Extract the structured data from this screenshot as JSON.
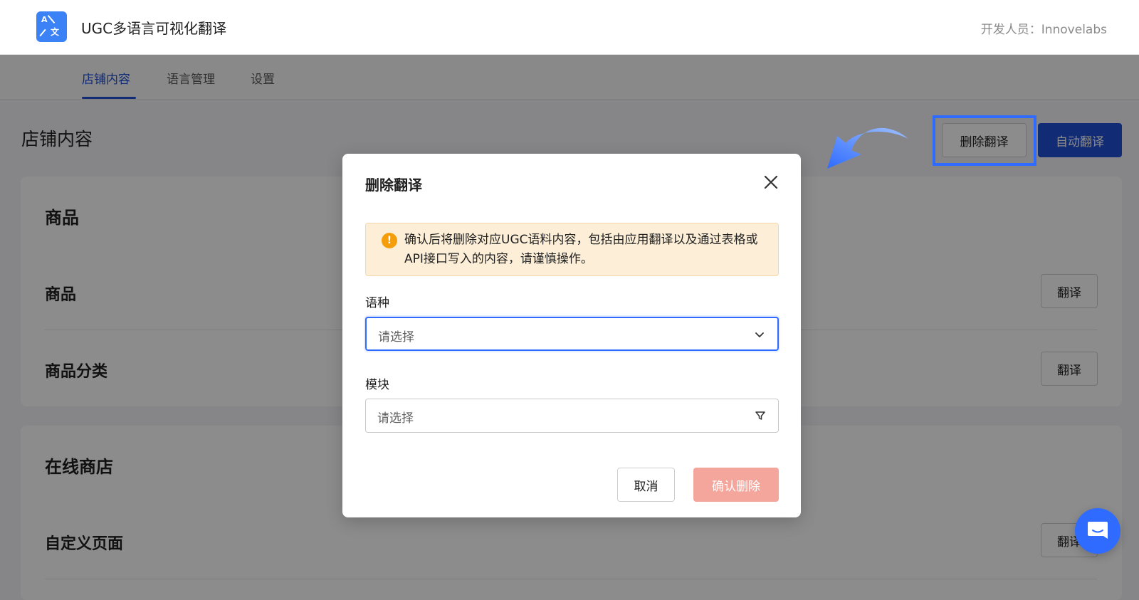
{
  "header": {
    "app_title": "UGC多语言可视化翻译",
    "developer": "开发人员：Innovelabs",
    "logo_glyph_a": "A",
    "logo_glyph_b": "文"
  },
  "tabs": [
    {
      "label": "店铺内容",
      "active": true
    },
    {
      "label": "语言管理",
      "active": false
    },
    {
      "label": "设置",
      "active": false
    }
  ],
  "page": {
    "title": "店铺内容",
    "delete_translation_label": "删除翻译",
    "auto_translate_label": "自动翻译"
  },
  "sections": [
    {
      "title": "商品",
      "rows": [
        {
          "label": "商品",
          "button": "翻译"
        },
        {
          "label": "商品分类",
          "button": "翻译"
        }
      ]
    },
    {
      "title": "在线商店",
      "rows": [
        {
          "label": "自定义页面",
          "button": "翻译"
        }
      ]
    }
  ],
  "modal": {
    "title": "删除翻译",
    "warning": "确认后将删除对应UGC语料内容，包括由应用翻译以及通过表格或API接口写入的内容，请谨慎操作。",
    "language_label": "语种",
    "language_placeholder": "请选择",
    "module_label": "模块",
    "module_placeholder": "请选择",
    "cancel_label": "取消",
    "confirm_label": "确认删除"
  },
  "colors": {
    "primary": "#1f4fd6",
    "highlight": "#2f6bff",
    "warning_bg": "#fdefd7",
    "warning_icon": "#f59e0b",
    "confirm_disabled": "#f4a69c"
  }
}
